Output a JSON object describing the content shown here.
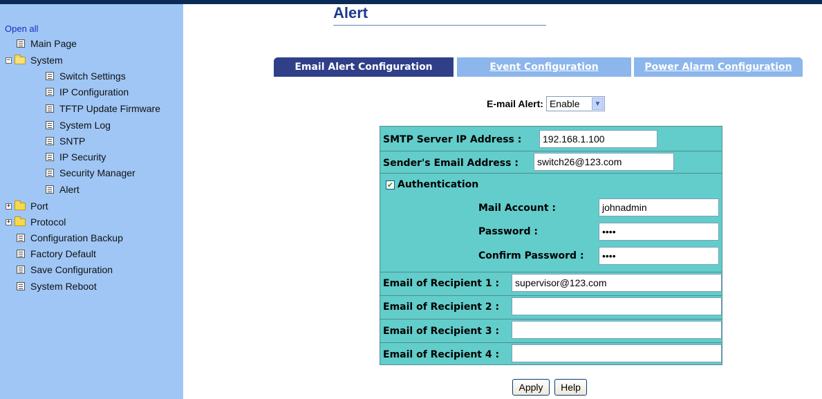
{
  "sidebar": {
    "open_all": "Open all",
    "main_page": "Main Page",
    "system": "System",
    "system_items": [
      "Switch Settings",
      "IP Configuration",
      "TFTP Update Firmware",
      "System Log",
      "SNTP",
      "IP Security",
      "Security Manager",
      "Alert"
    ],
    "port": "Port",
    "protocol": "Protocol",
    "bottom_items": [
      "Configuration Backup",
      "Factory Default",
      "Save Configuration",
      "System Reboot"
    ]
  },
  "page": {
    "title": "Alert"
  },
  "tabs": [
    "Email Alert Configuration",
    "Event Configuration",
    "Power Alarm Configuration"
  ],
  "email_alert": {
    "label": "E-mail Alert:",
    "value": "Enable"
  },
  "form": {
    "smtp_label": "SMTP Server IP Address :",
    "smtp_value": "192.168.1.100",
    "sender_label": "Sender's Email Address :",
    "sender_value": "switch26@123.com",
    "auth_label": "Authentication",
    "auth_checked": true,
    "mail_account_label": "Mail Account :",
    "mail_account_value": "johnadmin",
    "password_label": "Password :",
    "password_value": "••••",
    "confirm_label": "Confirm Password :",
    "confirm_value": "••••",
    "recipients": [
      {
        "label": "Email of Recipient 1 :",
        "value": "supervisor@123.com"
      },
      {
        "label": "Email of Recipient 2 :",
        "value": ""
      },
      {
        "label": "Email of Recipient 3 :",
        "value": ""
      },
      {
        "label": "Email of Recipient 4 :",
        "value": ""
      }
    ]
  },
  "buttons": {
    "apply": "Apply",
    "help": "Help"
  },
  "colors": {
    "sidebar_bg": "#9fc6f5",
    "tab_active": "#2f3f88",
    "tab_inactive": "#8cb6ec",
    "form_bg": "#62cdcb",
    "title": "#1d3a8a"
  },
  "icons": {
    "page": "page-icon",
    "folder": "folder-icon",
    "expand": "plus-box-icon",
    "collapse": "minus-box-icon",
    "dropdown": "chevron-down-icon",
    "check": "checkmark-icon"
  }
}
